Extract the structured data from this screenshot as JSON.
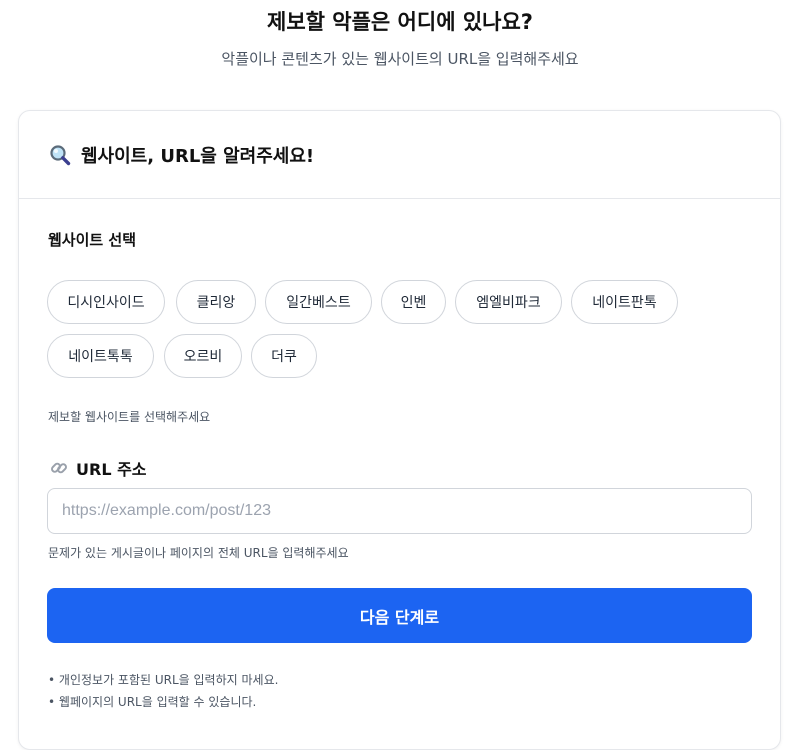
{
  "header": {
    "title": "제보할 악플은 어디에 있나요?",
    "subtitle": "악플이나 콘텐츠가 있는 웹사이트의 URL을 입력해주세요"
  },
  "card": {
    "title_icon": "magnifying-glass-icon",
    "title": "웹사이트, URL을 알려주세요!"
  },
  "site_select": {
    "label": "웹사이트 선택",
    "options": [
      "디시인사이드",
      "클리앙",
      "일간베스트",
      "인벤",
      "엠엘비파크",
      "네이트판톡",
      "네이트톡톡",
      "오르비",
      "더쿠"
    ],
    "hint": "제보할 웹사이트를 선택해주세요"
  },
  "url": {
    "icon": "link-icon",
    "label": "URL 주소",
    "placeholder": "https://example.com/post/123",
    "value": "",
    "hint": "문제가 있는 게시글이나 페이지의 전체 URL을 입력해주세요"
  },
  "actions": {
    "next_label": "다음 단계로"
  },
  "notes": [
    "개인정보가 포함된 URL을 입력하지 마세요.",
    "웹페이지의 URL을 입력할 수 있습니다."
  ],
  "colors": {
    "primary": "#1c64f2",
    "border": "#d1d5db",
    "muted_text": "#4b5563"
  }
}
